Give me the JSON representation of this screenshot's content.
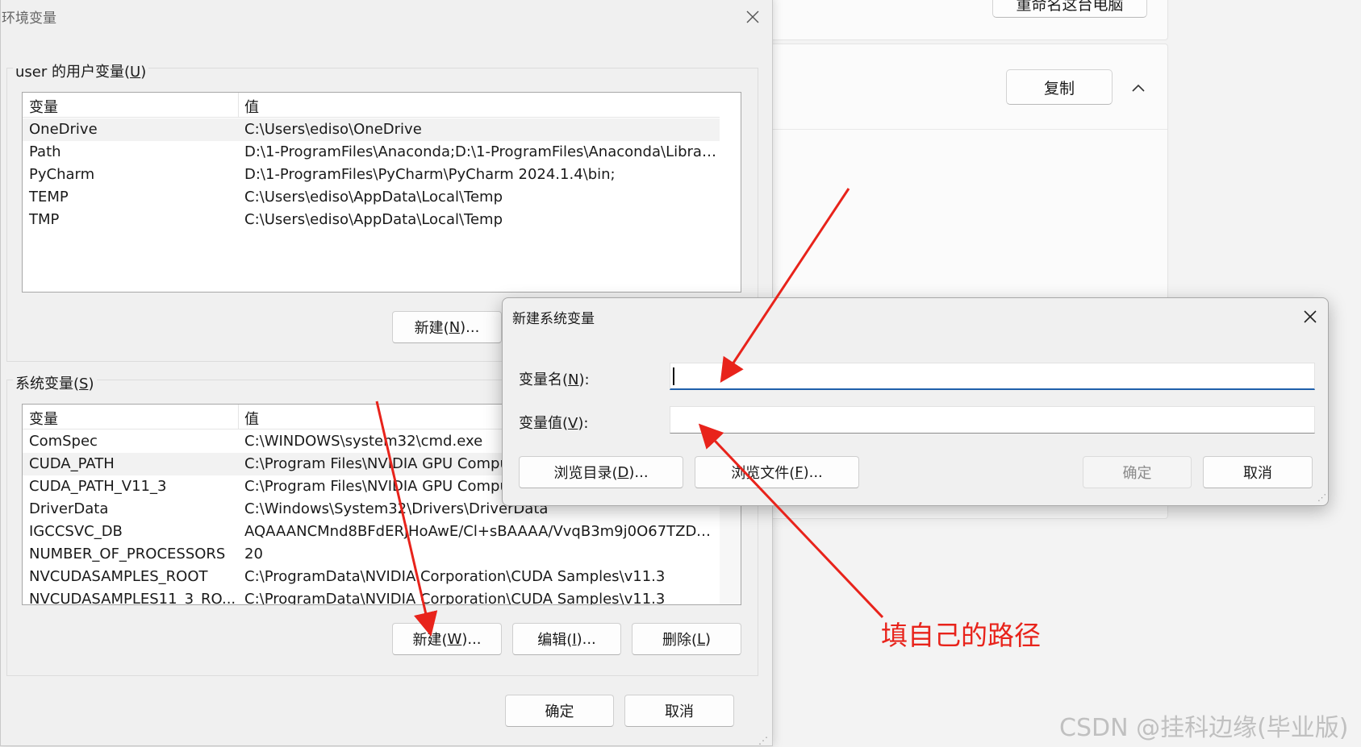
{
  "background": {
    "rename_button": "重命名这台电脑",
    "copy_button": "复制"
  },
  "env_dialog": {
    "title": "环境变量",
    "user_group": {
      "prefix": "user 的用户变量(",
      "key": "U",
      "suffix": ")"
    },
    "system_group": {
      "prefix": "系统变量(",
      "key": "S",
      "suffix": ")"
    },
    "columns": {
      "variable": "变量",
      "value": "值"
    },
    "user_vars": [
      {
        "name": "OneDrive",
        "value": "C:\\Users\\ediso\\OneDrive",
        "selected": true
      },
      {
        "name": "Path",
        "value": "D:\\1-ProgramFiles\\Anaconda;D:\\1-ProgramFiles\\Anaconda\\Librar..."
      },
      {
        "name": "PyCharm",
        "value": "D:\\1-ProgramFiles\\PyCharm\\PyCharm 2024.1.4\\bin;"
      },
      {
        "name": "TEMP",
        "value": "C:\\Users\\ediso\\AppData\\Local\\Temp"
      },
      {
        "name": "TMP",
        "value": "C:\\Users\\ediso\\AppData\\Local\\Temp"
      }
    ],
    "system_vars": [
      {
        "name": "ComSpec",
        "value": "C:\\WINDOWS\\system32\\cmd.exe"
      },
      {
        "name": "CUDA_PATH",
        "value": "C:\\Program Files\\NVIDIA GPU Compu",
        "selected": true
      },
      {
        "name": "CUDA_PATH_V11_3",
        "value": "C:\\Program Files\\NVIDIA GPU Compu"
      },
      {
        "name": "DriverData",
        "value": "C:\\Windows\\System32\\Drivers\\DriverData"
      },
      {
        "name": "IGCCSVC_DB",
        "value": "AQAAANCMnd8BFdERjHoAwE/Cl+sBAAAA/VvqB3m9j0O67TZDV..."
      },
      {
        "name": "NUMBER_OF_PROCESSORS",
        "value": "20"
      },
      {
        "name": "NVCUDASAMPLES_ROOT",
        "value": "C:\\ProgramData\\NVIDIA Corporation\\CUDA Samples\\v11.3"
      },
      {
        "name": "NVCUDASAMPLES11_3_RO...",
        "value": "C:\\ProgramData\\NVIDIA Corporation\\CUDA Samples\\v11.3"
      }
    ],
    "buttons": {
      "new_user": {
        "prefix": "新建(",
        "key": "N",
        "suffix": ")..."
      },
      "new_system": {
        "prefix": "新建(",
        "key": "W",
        "suffix": ")..."
      },
      "edit_system": {
        "prefix": "编辑(",
        "key": "I",
        "suffix": ")..."
      },
      "delete_system": {
        "prefix": "删除(",
        "key": "L",
        "suffix": ")"
      },
      "ok": "确定",
      "cancel": "取消"
    }
  },
  "new_var_dialog": {
    "title": "新建系统变量",
    "name_label": {
      "prefix": "变量名(",
      "key": "N",
      "suffix": "):"
    },
    "value_label": {
      "prefix": "变量值(",
      "key": "V",
      "suffix": "):"
    },
    "name_value": "",
    "value_value": "",
    "buttons": {
      "browse_dir": {
        "prefix": "浏览目录(",
        "key": "D",
        "suffix": ")..."
      },
      "browse_file": {
        "prefix": "浏览文件(",
        "key": "F",
        "suffix": ")..."
      },
      "ok": "确定",
      "cancel": "取消"
    }
  },
  "annotation": {
    "text": "填自己的路径",
    "color": "#e8231b"
  },
  "watermark": "CSDN @挂科边缘(毕业版)"
}
